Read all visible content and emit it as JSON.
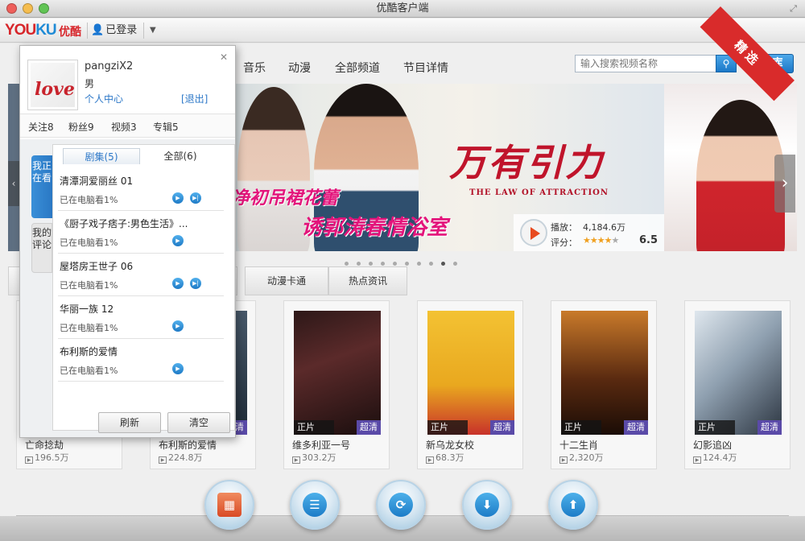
{
  "window": {
    "title": "优酷客户端"
  },
  "toolbar": {
    "logo_you": "YOU",
    "logo_ku": "KU",
    "logo_cn": "优酷",
    "user_status": "已登录"
  },
  "nav": {
    "items": [
      "音乐",
      "动漫",
      "全部频道",
      "节目详情"
    ]
  },
  "search": {
    "placeholder": "输入搜索视频名称",
    "button_label": "搜库"
  },
  "banner": {
    "title": "万有引力",
    "subtitle": "THE LAW OF ATTRACTION",
    "slogan1": "净初吊裙花蕾",
    "slogan2": "诱郭涛春情浴室",
    "plays_label": "播放：",
    "plays_value": "4,184.6万",
    "rating_label": "评分：",
    "rating": "6.5",
    "rating_stars": 3.5,
    "ribbon": "精选",
    "dots_count": 10,
    "active_dot": 8
  },
  "category_tabs": [
    "动漫卡通",
    "热点资讯"
  ],
  "cards": [
    {
      "title": "亡命捻劫",
      "plays": "196.5万",
      "tag_left": "",
      "tag_right": ""
    },
    {
      "title": "布利斯的爱情",
      "plays": "224.8万",
      "tag_left": "",
      "tag_right": "超清"
    },
    {
      "title": "维多利亚一号",
      "plays": "303.2万",
      "tag_left": "正片",
      "tag_right": "超清"
    },
    {
      "title": "新乌龙女校",
      "plays": "68.3万",
      "tag_left": "正片",
      "tag_right": "超清"
    },
    {
      "title": "十二生肖",
      "plays": "2,320万",
      "tag_left": "正片",
      "tag_right": "超清"
    },
    {
      "title": "幻影追凶",
      "plays": "124.4万",
      "tag_left": "正片",
      "tag_right": "超清"
    }
  ],
  "popup": {
    "username": "pangziX2",
    "gender": "男",
    "personal_center": "个人中心",
    "logout": "[退出]",
    "stats": [
      "关注8",
      "粉丝9",
      "视频3",
      "专辑5"
    ],
    "vtab_watching": "我正在看",
    "vtab_comments": "我的评论",
    "subtab_series": "剧集(5)",
    "subtab_all": "全部(6)",
    "history": [
      {
        "title": "清潭洞爱丽丝 01",
        "progress": "已在电脑看1%",
        "has_next": true
      },
      {
        "title": "《厨子戏子痞子:男色生活》...",
        "progress": "已在电脑看1%",
        "has_next": false
      },
      {
        "title": "屋塔房王世子 06",
        "progress": "已在电脑看1%",
        "has_next": true
      },
      {
        "title": "华丽一族 12",
        "progress": "已在电脑看1%",
        "has_next": false
      },
      {
        "title": "布利斯的爱情",
        "progress": "已在电脑看1%",
        "has_next": false
      }
    ],
    "refresh": "刷新",
    "clear": "清空"
  }
}
